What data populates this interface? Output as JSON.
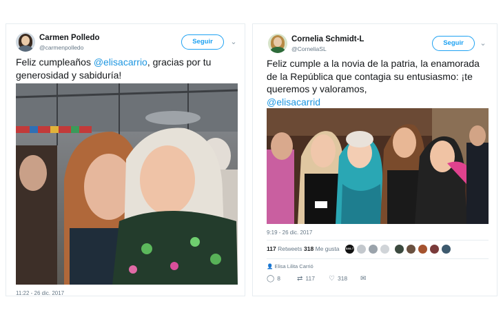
{
  "left_tweet": {
    "author_name": "Carmen Polledo",
    "author_handle": "@carmenpolledo",
    "follow_label": "Seguir",
    "text_before": "Feliz cumpleaños ",
    "mention": "@elisacarrio",
    "text_after": ", gracias por tu generosidad y sabiduría!",
    "timestamp": "11:22 - 26 dic. 2017",
    "photo_icon": "photo-two-women"
  },
  "right_tweet": {
    "author_name": "Cornelia Schmidt-L",
    "author_handle": "@CorneliaSL",
    "follow_label": "Seguir",
    "text": "Feliz cumple a la novia de la patria, la enamorada de la República que contagia su entusiasmo: ¡te queremos y valoramos,",
    "mention": "@elisacarrid",
    "timestamp": "9:19 - 26 dic. 2017",
    "retweets_count": "117",
    "retweets_label": "Retweets",
    "likes_count": "318",
    "likes_label": "Me gusta",
    "liked_by_badge": "DAIL.T",
    "shared_by": "Elisa Lilita Carrió",
    "actions": {
      "reply_count": "8",
      "retweet_count": "117",
      "like_count": "318"
    },
    "photo_icon": "photo-group-of-women"
  },
  "colors": {
    "link": "#1b95e0",
    "follow": "#1da1f2",
    "secondary_text": "#657786"
  }
}
